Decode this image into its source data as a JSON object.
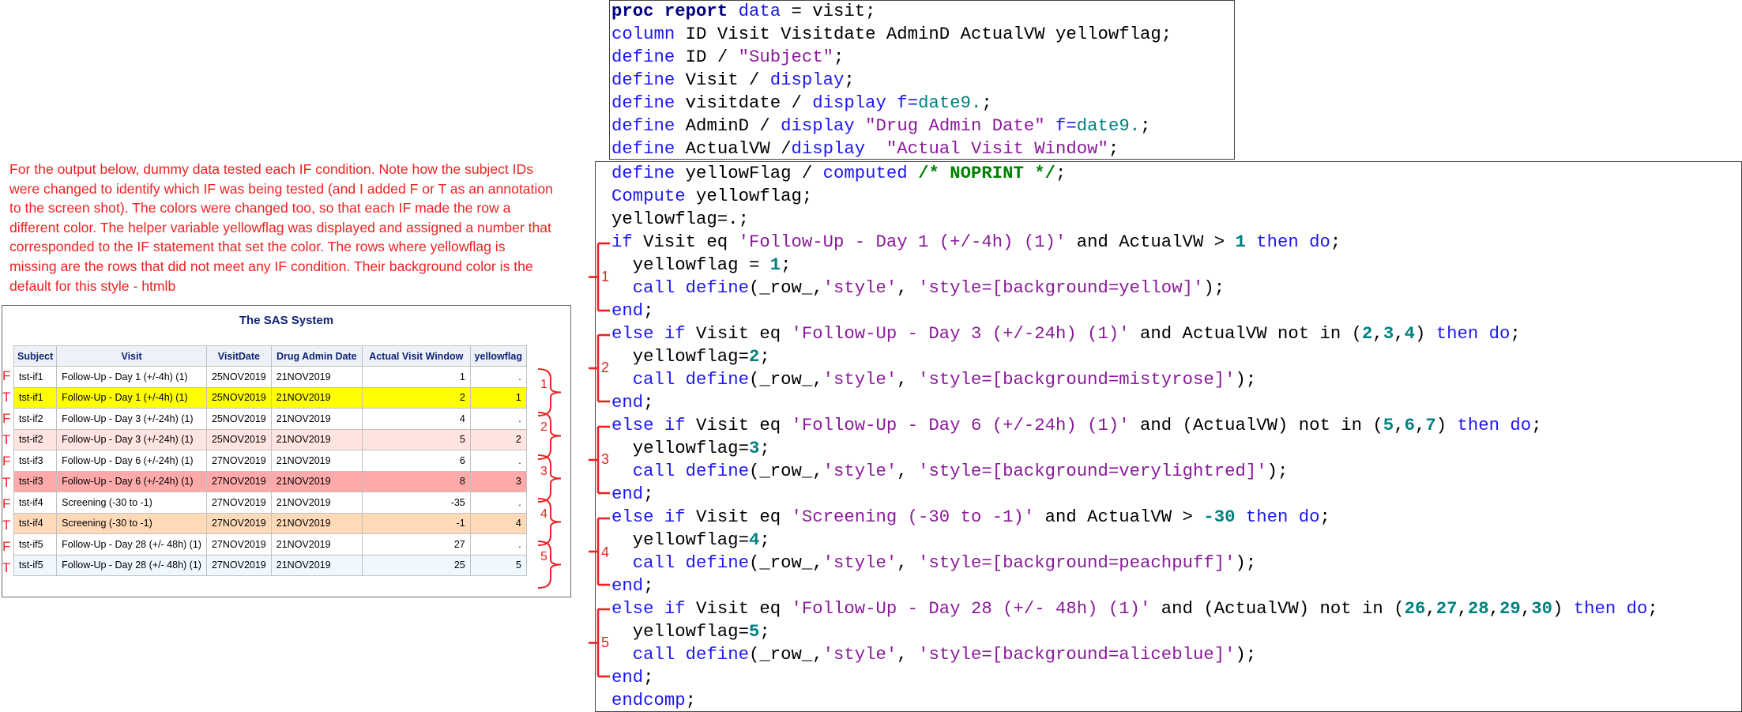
{
  "note": {
    "text": "For the output below, dummy data tested each IF condition. Note how the subject IDs were changed to identify which IF was being tested (and I added F or T as an annotation to the screen shot). The colors were changed too, so that each IF made the row a different color. The helper variable yellowflag was displayed and assigned a number that corresponded to the IF statement that set the color. The rows where yellowflag is missing are the rows that did not meet any IF condition. Their background color is the default for this style - htmlb",
    "color": "#ee2222"
  },
  "report": {
    "title": "The SAS System",
    "headers": [
      "Subject",
      "Visit",
      "VisitDate",
      "Drug Admin Date",
      "Actual Visit Window",
      "yellowflag"
    ],
    "rows": [
      {
        "mark": "F",
        "subject": "tst-if1",
        "visit": "Follow-Up - Day 1 (+/-4h) (1)",
        "visitdate": "25NOV2019",
        "admin": "21NOV2019",
        "window": "1",
        "flag": ".",
        "bg": "#ffffff"
      },
      {
        "mark": "T",
        "subject": "tst-if1",
        "visit": "Follow-Up - Day 1 (+/-4h) (1)",
        "visitdate": "25NOV2019",
        "admin": "21NOV2019",
        "window": "2",
        "flag": "1",
        "bg": "#ffff00"
      },
      {
        "mark": "F",
        "subject": "tst-if2",
        "visit": "Follow-Up - Day 3 (+/-24h) (1)",
        "visitdate": "25NOV2019",
        "admin": "21NOV2019",
        "window": "4",
        "flag": ".",
        "bg": "#ffffff"
      },
      {
        "mark": "T",
        "subject": "tst-if2",
        "visit": "Follow-Up - Day 3 (+/-24h) (1)",
        "visitdate": "25NOV2019",
        "admin": "21NOV2019",
        "window": "5",
        "flag": "2",
        "bg": "#ffe4e1"
      },
      {
        "mark": "F",
        "subject": "tst-if3",
        "visit": "Follow-Up - Day 6 (+/-24h) (1)",
        "visitdate": "27NOV2019",
        "admin": "21NOV2019",
        "window": "6",
        "flag": ".",
        "bg": "#ffffff"
      },
      {
        "mark": "T",
        "subject": "tst-if3",
        "visit": "Follow-Up - Day 6 (+/-24h) (1)",
        "visitdate": "27NOV2019",
        "admin": "21NOV2019",
        "window": "8",
        "flag": "3",
        "bg": "#ffaaaa"
      },
      {
        "mark": "F",
        "subject": "tst-if4",
        "visit": "Screening (-30 to -1)",
        "visitdate": "27NOV2019",
        "admin": "21NOV2019",
        "window": "-35",
        "flag": ".",
        "bg": "#ffffff"
      },
      {
        "mark": "T",
        "subject": "tst-if4",
        "visit": "Screening (-30 to -1)",
        "visitdate": "27NOV2019",
        "admin": "21NOV2019",
        "window": "-1",
        "flag": "4",
        "bg": "#ffdab9"
      },
      {
        "mark": "F",
        "subject": "tst-if5",
        "visit": "Follow-Up - Day 28 (+/- 48h) (1)",
        "visitdate": "27NOV2019",
        "admin": "21NOV2019",
        "window": "27",
        "flag": ".",
        "bg": "#ffffff"
      },
      {
        "mark": "T",
        "subject": "tst-if5",
        "visit": "Follow-Up - Day 28 (+/- 48h) (1)",
        "visitdate": "27NOV2019",
        "admin": "21NOV2019",
        "window": "25",
        "flag": "5",
        "bg": "#f0f8ff"
      }
    ],
    "group_labels": [
      "1",
      "2",
      "3",
      "4",
      "5"
    ]
  },
  "code_top": [
    [
      [
        "bkw",
        "proc report"
      ],
      [
        "kw",
        " data "
      ],
      [
        "",
        "= visit;"
      ]
    ],
    [
      [
        "kw",
        "column"
      ],
      [
        "",
        " ID Visit Visitdate AdminD ActualVW yellowflag;"
      ]
    ],
    [
      [
        "kw",
        "define"
      ],
      [
        "",
        " ID / "
      ],
      [
        "str",
        "\"Subject\""
      ],
      [
        "",
        ";"
      ]
    ],
    [
      [
        "kw",
        "define"
      ],
      [
        "",
        " Visit / "
      ],
      [
        "kw",
        "display"
      ],
      [
        "",
        ";"
      ]
    ],
    [
      [
        "kw",
        "define"
      ],
      [
        "",
        " visitdate / "
      ],
      [
        "kw",
        "display"
      ],
      [
        "",
        " "
      ],
      [
        "kw",
        "f="
      ],
      [
        "fmt",
        "date9."
      ],
      [
        "",
        ";"
      ]
    ],
    [
      [
        "kw",
        "define"
      ],
      [
        "",
        " AdminD / "
      ],
      [
        "kw",
        "display"
      ],
      [
        "",
        " "
      ],
      [
        "str",
        "\"Drug Admin Date\""
      ],
      [
        "",
        " "
      ],
      [
        "kw",
        "f="
      ],
      [
        "fmt",
        "date9."
      ],
      [
        "",
        ";"
      ]
    ],
    [
      [
        "kw",
        "define"
      ],
      [
        "",
        " ActualVW /"
      ],
      [
        "kw",
        "display"
      ],
      [
        "",
        "  "
      ],
      [
        "str",
        "\"Actual Visit Window\""
      ],
      [
        "",
        ";"
      ]
    ]
  ],
  "code_bottom": [
    [
      [
        "kw",
        "define"
      ],
      [
        "",
        " yellowFlag / "
      ],
      [
        "kw",
        "computed"
      ],
      [
        "",
        " "
      ],
      [
        "cmt",
        "/* NOPRINT */"
      ],
      [
        "",
        ";"
      ]
    ],
    [
      [
        "kw",
        "Compute"
      ],
      [
        "",
        " yellowflag;"
      ]
    ],
    [
      [
        "",
        "yellowflag=."
      ],
      [
        "",
        ";"
      ]
    ],
    [
      [
        "kw",
        "if"
      ],
      [
        "",
        " Visit eq "
      ],
      [
        "str",
        "'Follow-Up - Day 1 (+/-4h) (1)'"
      ],
      [
        "",
        " and ActualVW > "
      ],
      [
        "num",
        "1"
      ],
      [
        "",
        " "
      ],
      [
        "kw",
        "then do"
      ],
      [
        "",
        ";"
      ]
    ],
    [
      [
        "",
        "  yellowflag = "
      ],
      [
        "num",
        "1"
      ],
      [
        "",
        ";"
      ]
    ],
    [
      [
        "",
        "  "
      ],
      [
        "kw",
        "call define"
      ],
      [
        "",
        "(_row_,"
      ],
      [
        "str",
        "'style'"
      ],
      [
        ", ",
        ", "
      ],
      [
        "str",
        "'style=[background=yellow]'"
      ],
      [
        "",
        ");"
      ]
    ],
    [
      [
        "kw",
        "end"
      ],
      [
        "",
        ";"
      ]
    ],
    [
      [
        "kw",
        "else if"
      ],
      [
        "",
        " Visit eq "
      ],
      [
        "str",
        "'Follow-Up - Day 3 (+/-24h) (1)'"
      ],
      [
        "",
        " and ActualVW not in ("
      ],
      [
        "num",
        "2"
      ],
      [
        "",
        ","
      ],
      [
        "num",
        "3"
      ],
      [
        "",
        ","
      ],
      [
        "num",
        "4"
      ],
      [
        "",
        ") "
      ],
      [
        "kw",
        "then do"
      ],
      [
        "",
        ";"
      ]
    ],
    [
      [
        "",
        "  yellowflag="
      ],
      [
        "num",
        "2"
      ],
      [
        "",
        ";"
      ]
    ],
    [
      [
        "",
        "  "
      ],
      [
        "kw",
        "call define"
      ],
      [
        "",
        "(_row_,"
      ],
      [
        "str",
        "'style'"
      ],
      [
        "",
        ", "
      ],
      [
        "str",
        "'style=[background=mistyrose]'"
      ],
      [
        "",
        ");"
      ]
    ],
    [
      [
        "kw",
        "end"
      ],
      [
        "",
        ";"
      ]
    ],
    [
      [
        "kw",
        "else if"
      ],
      [
        "",
        " Visit eq "
      ],
      [
        "str",
        "'Follow-Up - Day 6 (+/-24h) (1)'"
      ],
      [
        "",
        " and (ActualVW) not in ("
      ],
      [
        "num",
        "5"
      ],
      [
        "",
        ","
      ],
      [
        "num",
        "6"
      ],
      [
        "",
        ","
      ],
      [
        "num",
        "7"
      ],
      [
        "",
        ") "
      ],
      [
        "kw",
        "then do"
      ],
      [
        "",
        ";"
      ]
    ],
    [
      [
        "",
        "  yellowflag="
      ],
      [
        "num",
        "3"
      ],
      [
        "",
        ";"
      ]
    ],
    [
      [
        "",
        "  "
      ],
      [
        "kw",
        "call define"
      ],
      [
        "",
        "(_row_,"
      ],
      [
        "str",
        "'style'"
      ],
      [
        "",
        ", "
      ],
      [
        "str",
        "'style=[background=verylightred]'"
      ],
      [
        "",
        ");"
      ]
    ],
    [
      [
        "kw",
        "end"
      ],
      [
        "",
        ";"
      ]
    ],
    [
      [
        "kw",
        "else if"
      ],
      [
        "",
        " Visit eq "
      ],
      [
        "str",
        "'Screening (-30 to -1)'"
      ],
      [
        "",
        " and ActualVW > "
      ],
      [
        "num",
        "-30"
      ],
      [
        "",
        " "
      ],
      [
        "kw",
        "then do"
      ],
      [
        "",
        ";"
      ]
    ],
    [
      [
        "",
        "  yellowflag="
      ],
      [
        "num",
        "4"
      ],
      [
        "",
        ";"
      ]
    ],
    [
      [
        "",
        "  "
      ],
      [
        "kw",
        "call define"
      ],
      [
        "",
        "(_row_,"
      ],
      [
        "str",
        "'style'"
      ],
      [
        "",
        ", "
      ],
      [
        "str",
        "'style=[background=peachpuff]'"
      ],
      [
        "",
        ");"
      ]
    ],
    [
      [
        "kw",
        "end"
      ],
      [
        "",
        ";"
      ]
    ],
    [
      [
        "kw",
        "else if"
      ],
      [
        "",
        " Visit eq "
      ],
      [
        "str",
        "'Follow-Up - Day 28 (+/- 48h) (1)'"
      ],
      [
        "",
        " and (ActualVW) not in ("
      ],
      [
        "num",
        "26"
      ],
      [
        "",
        ","
      ],
      [
        "num",
        "27"
      ],
      [
        "",
        ","
      ],
      [
        "num",
        "28"
      ],
      [
        "",
        ","
      ],
      [
        "num",
        "29"
      ],
      [
        "",
        ","
      ],
      [
        "num",
        "30"
      ],
      [
        "",
        ") "
      ],
      [
        "kw",
        "then do"
      ],
      [
        "",
        ";"
      ]
    ],
    [
      [
        "",
        "  yellowflag="
      ],
      [
        "num",
        "5"
      ],
      [
        "",
        ";"
      ]
    ],
    [
      [
        "",
        "  "
      ],
      [
        "kw",
        "call define"
      ],
      [
        "",
        "(_row_,"
      ],
      [
        "str",
        "'style'"
      ],
      [
        "",
        ", "
      ],
      [
        "str",
        "'style=[background=aliceblue]'"
      ],
      [
        "",
        ");"
      ]
    ],
    [
      [
        "kw",
        "end"
      ],
      [
        "",
        ";"
      ]
    ],
    [
      [
        "kw",
        "endcomp"
      ],
      [
        "",
        ";"
      ]
    ]
  ],
  "code_group_labels": [
    "1",
    "2",
    "3",
    "4",
    "5"
  ],
  "annotation_color": "#ee2222"
}
